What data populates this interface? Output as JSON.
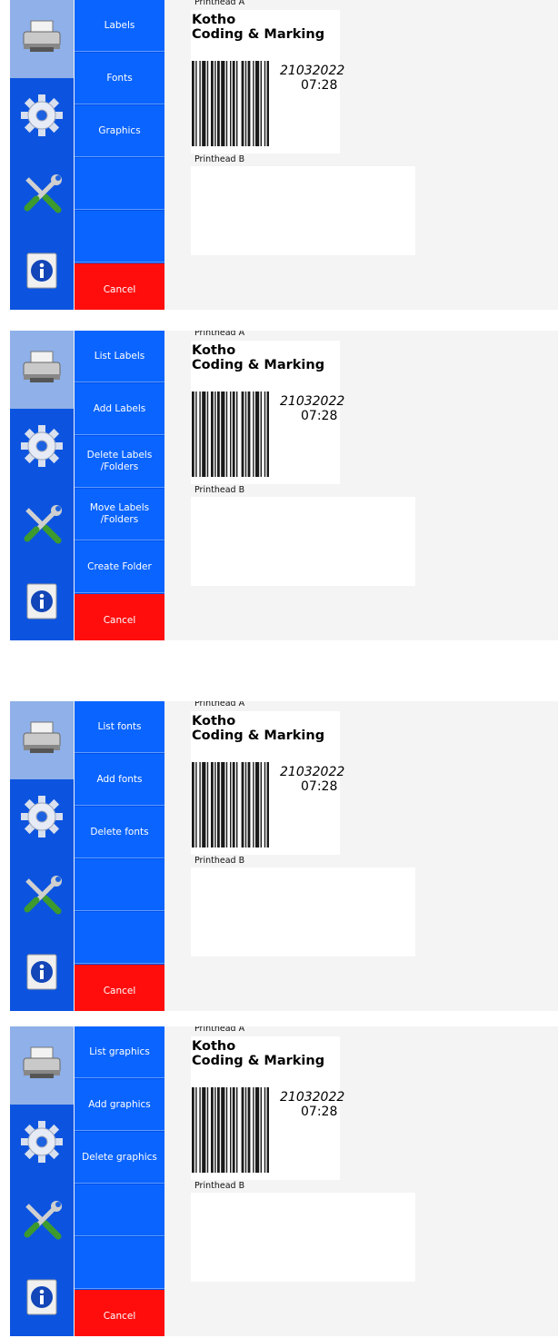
{
  "printhead_a_label": "Printhead A",
  "printhead_b_label": "Printhead B",
  "label_preview": {
    "company_line1": "Kotho",
    "company_line2": "Coding & Marking",
    "date": "21032022",
    "time": "07:28"
  },
  "icons": [
    "printer-icon",
    "gear-icon",
    "tools-icon",
    "info-icon"
  ],
  "panels": [
    {
      "menu": [
        "Labels",
        "Fonts",
        "Graphics",
        "",
        "",
        "Cancel"
      ]
    },
    {
      "menu": [
        "List Labels",
        "Add Labels",
        "Delete Labels\n/Folders",
        "Move Labels\n/Folders",
        "Create Folder",
        "Cancel"
      ]
    },
    {
      "menu": [
        "List fonts",
        "Add fonts",
        "Delete fonts",
        "",
        "",
        "Cancel"
      ]
    },
    {
      "menu": [
        "List graphics",
        "Add graphics",
        "Delete graphics",
        "",
        "",
        "Cancel"
      ]
    }
  ],
  "colors": {
    "sidebar": "#0c54df",
    "menu_button": "#0a64ff",
    "cancel": "#ff0d0d",
    "active_sidebar": "#8fb0e8"
  }
}
